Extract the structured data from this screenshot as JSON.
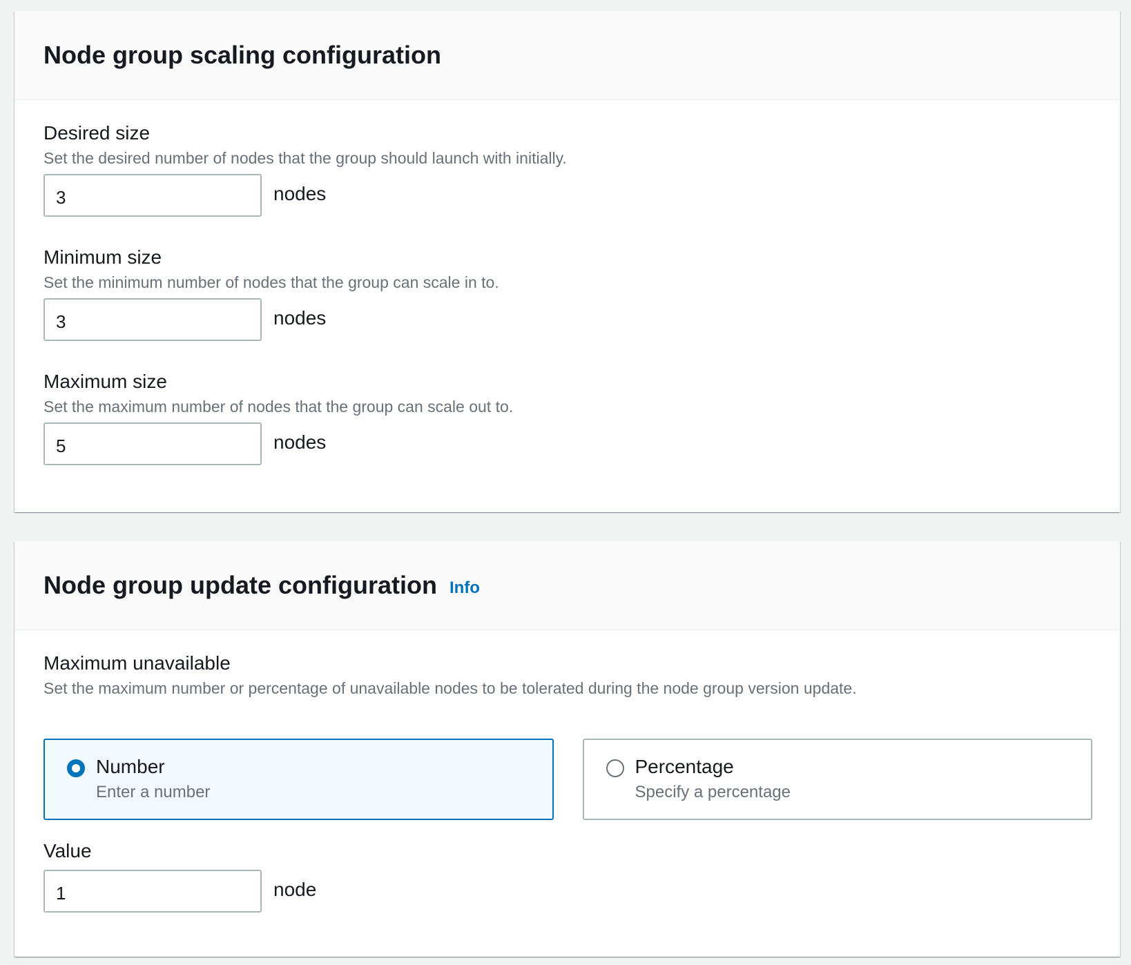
{
  "scaling": {
    "title": "Node group scaling configuration",
    "desired": {
      "label": "Desired size",
      "description": "Set the desired number of nodes that the group should launch with initially.",
      "value": "3",
      "unit": "nodes"
    },
    "minimum": {
      "label": "Minimum size",
      "description": "Set the minimum number of nodes that the group can scale in to.",
      "value": "3",
      "unit": "nodes"
    },
    "maximum": {
      "label": "Maximum size",
      "description": "Set the maximum number of nodes that the group can scale out to.",
      "value": "5",
      "unit": "nodes"
    }
  },
  "update": {
    "title": "Node group update configuration",
    "info_link": "Info",
    "max_unavailable": {
      "label": "Maximum unavailable",
      "description": "Set the maximum number or percentage of unavailable nodes to be tolerated during the node group version update."
    },
    "options": [
      {
        "label": "Number",
        "description": "Enter a number",
        "selected": true
      },
      {
        "label": "Percentage",
        "description": "Specify a percentage",
        "selected": false
      }
    ],
    "value_field": {
      "label": "Value",
      "value": "1",
      "unit": "node"
    }
  },
  "colors": {
    "accent": "#0073bb",
    "selected_tile_bg": "#f1faff",
    "muted_text": "#687078"
  }
}
